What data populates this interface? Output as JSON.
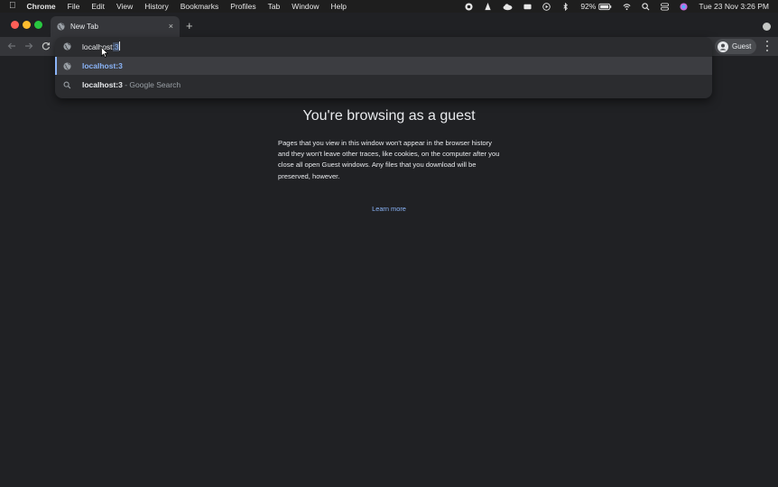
{
  "menubar": {
    "app": "Chrome",
    "items": [
      "File",
      "Edit",
      "View",
      "History",
      "Bookmarks",
      "Profiles",
      "Tab",
      "Window",
      "Help"
    ],
    "battery": "92%",
    "datetime": "Tue 23 Nov  3:26 PM"
  },
  "tab": {
    "title": "New Tab",
    "close": "×",
    "new_tab": "+"
  },
  "omnibox": {
    "typed": "localhost",
    "completion": ":3"
  },
  "suggestions": [
    {
      "primary": "localhost:3",
      "secondary": ""
    },
    {
      "primary": "localhost:3",
      "secondary": " - Google Search"
    }
  ],
  "profile": {
    "label": "Guest"
  },
  "page": {
    "title": "You're browsing as a guest",
    "body": "Pages that you view in this window won't appear in the browser history and they won't leave other traces, like cookies, on the computer after you close all open Guest windows. Any files that you download will be preserved, however.",
    "learn_more": "Learn more"
  },
  "colors": {
    "background": "#202124",
    "toolbar": "#35363a",
    "accent": "#8ab4f8"
  }
}
